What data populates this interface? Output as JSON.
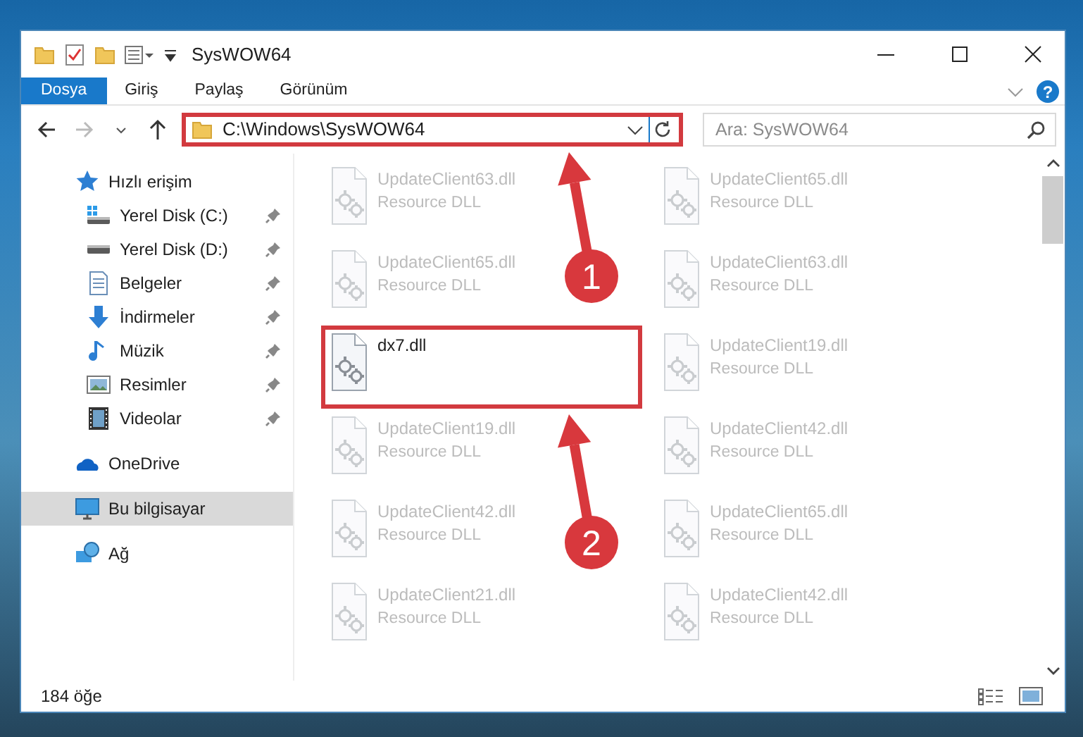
{
  "window": {
    "title": "SysWOW64"
  },
  "ribbon_tabs": [
    {
      "label": "Dosya",
      "kind": "file",
      "selected": false
    },
    {
      "label": "Giriş",
      "kind": "tab",
      "selected": false
    },
    {
      "label": "Paylaş",
      "kind": "tab",
      "selected": false
    },
    {
      "label": "Görünüm",
      "kind": "tab",
      "selected": false
    }
  ],
  "help_button": {
    "label": "?"
  },
  "address_bar": {
    "path": "C:\\Windows\\SysWOW64",
    "highlighted": true
  },
  "search": {
    "placeholder": "Ara: SysWOW64"
  },
  "sidebar": {
    "items": [
      {
        "label": "Hızlı erişim",
        "kind": "star",
        "selected": false,
        "children": [
          {
            "label": "Yerel Disk (C:)",
            "kind": "system-drive",
            "selected": false,
            "pinned": true
          },
          {
            "label": "Yerel Disk (D:)",
            "kind": "drive",
            "selected": false,
            "pinned": true
          },
          {
            "label": "Belgeler",
            "kind": "documents",
            "selected": false,
            "pinned": true
          },
          {
            "label": "İndirmeler",
            "kind": "download",
            "selected": false,
            "pinned": true
          },
          {
            "label": "Müzik",
            "kind": "music",
            "selected": false,
            "pinned": true
          },
          {
            "label": "Resimler",
            "kind": "pictures",
            "selected": false,
            "pinned": true
          },
          {
            "label": "Videolar",
            "kind": "videos",
            "selected": false,
            "pinned": true
          }
        ]
      },
      {
        "label": "OneDrive",
        "kind": "cloud",
        "selected": false
      },
      {
        "label": "Bu bilgisayar",
        "kind": "computer",
        "selected": true
      },
      {
        "label": "Ağ",
        "kind": "network",
        "selected": false
      }
    ]
  },
  "files": [
    {
      "name": "UpdateClient63.dll",
      "type": "Resource DLL",
      "dimmed": true,
      "highlighted": false
    },
    {
      "name": "UpdateClient65.dll",
      "type": "Resource DLL",
      "dimmed": true,
      "highlighted": false
    },
    {
      "name": "UpdateClient65.dll",
      "type": "Resource DLL",
      "dimmed": true,
      "highlighted": false
    },
    {
      "name": "UpdateClient63.dll",
      "type": "Resource DLL",
      "dimmed": true,
      "highlighted": false
    },
    {
      "name": "dx7.dll",
      "dimmed": false,
      "highlighted": true
    },
    {
      "name": "UpdateClient19.dll",
      "type": "Resource DLL",
      "dimmed": true,
      "highlighted": false
    },
    {
      "name": "UpdateClient19.dll",
      "type": "Resource DLL",
      "dimmed": true,
      "highlighted": false
    },
    {
      "name": "UpdateClient42.dll",
      "type": "Resource DLL",
      "dimmed": true,
      "highlighted": false
    },
    {
      "name": "UpdateClient42.dll",
      "type": "Resource DLL",
      "dimmed": true,
      "highlighted": false
    },
    {
      "name": "UpdateClient65.dll",
      "type": "Resource DLL",
      "dimmed": true,
      "highlighted": false
    },
    {
      "name": "UpdateClient21.dll",
      "type": "Resource DLL",
      "dimmed": true,
      "highlighted": false
    },
    {
      "name": "UpdateClient42.dll",
      "type": "Resource DLL",
      "dimmed": true,
      "highlighted": false
    }
  ],
  "status_bar": {
    "item_count": "184 öğe"
  },
  "callouts": [
    {
      "number": "1"
    },
    {
      "number": "2"
    }
  ]
}
